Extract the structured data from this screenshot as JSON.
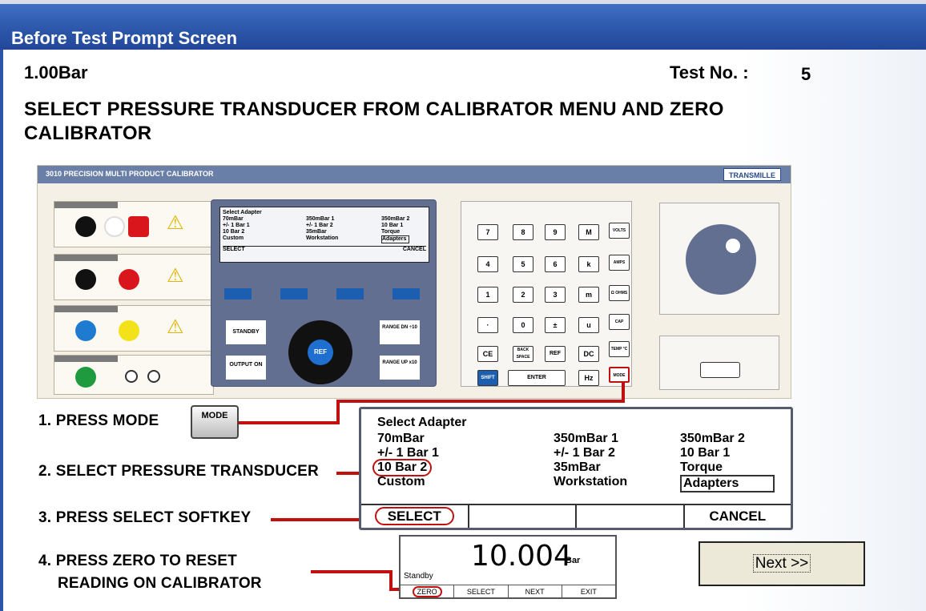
{
  "window": {
    "title": "Before Test Prompt Screen"
  },
  "header": {
    "pressure": "1.00Bar",
    "test_label": "Test No. :",
    "test_number": "5"
  },
  "instruction": "SELECT PRESSURE TRANSDUCER FROM CALIBRATOR MENU AND ZERO CALIBRATOR",
  "device": {
    "model": "3010 PRECISION MULTI PRODUCT CALIBRATOR",
    "brand": "TRANSMILLE",
    "small_lcd": {
      "title": "Select Adapter",
      "col1": [
        "70mBar",
        "+/- 1 Bar 1",
        "10 Bar 2",
        "Custom"
      ],
      "col2": [
        "350mBar 1",
        "+/- 1 Bar 2",
        "35mBar",
        "Workstation"
      ],
      "col3": [
        "350mBar 2",
        "10 Bar 1",
        "Torque",
        "Adapters"
      ],
      "soft": [
        "SELECT",
        "",
        "",
        "CANCEL"
      ]
    },
    "keys": {
      "standby": "STANDBY",
      "output": "OUTPUT ON",
      "ref": "REF",
      "range_dn": "RANGE DN ÷10",
      "range_up": "RANGE UP x10",
      "k7": "7",
      "k8": "8",
      "k9": "9",
      "kM": "M",
      "volts": "VOLTS",
      "k4": "4",
      "k5": "5",
      "k6": "6",
      "kk": "k",
      "amps": "AMPS",
      "k1": "1",
      "k2": "2",
      "k3": "3",
      "km": "m",
      "ohms": "Ω OHMS",
      "kdot": "·",
      "k0": "0",
      "kpm": "±",
      "ku": "u",
      "cap": "CAP",
      "ce": "CE",
      "back": "BACK SPACE",
      "refkey": "REF",
      "dc": "DC",
      "temp": "TEMP °C",
      "shift": "SHIFT",
      "enter": "ENTER",
      "hz": "Hz",
      "mode": "MODE"
    }
  },
  "steps": {
    "s1": "1. PRESS MODE",
    "mode_key": "MODE",
    "s2": "2. SELECT PRESSURE TRANSDUCER",
    "s3": "3. PRESS SELECT SOFTKEY",
    "s4a": "4. PRESS ZERO TO RESET",
    "s4b": "READING ON CALIBRATOR"
  },
  "big_lcd": {
    "title": "Select Adapter",
    "col1": [
      "70mBar",
      "+/- 1 Bar 1",
      "10 Bar 2",
      "Custom"
    ],
    "col2": [
      "350mBar 1",
      "+/- 1 Bar 2",
      "35mBar",
      "Workstation"
    ],
    "col3": [
      "350mBar 2",
      "10 Bar 1",
      "Torque",
      "Adapters"
    ],
    "soft": [
      "SELECT",
      "",
      "",
      "CANCEL"
    ]
  },
  "readout": {
    "value": "10.004",
    "unit": "Bar",
    "status": "Standby",
    "soft": [
      "ZERO",
      "SELECT",
      "NEXT",
      "EXIT"
    ]
  },
  "next_button": "Next >>",
  "colors": {
    "title_bar": "#2b55a8",
    "highlight": "#c01010",
    "panel": "#626f90"
  }
}
